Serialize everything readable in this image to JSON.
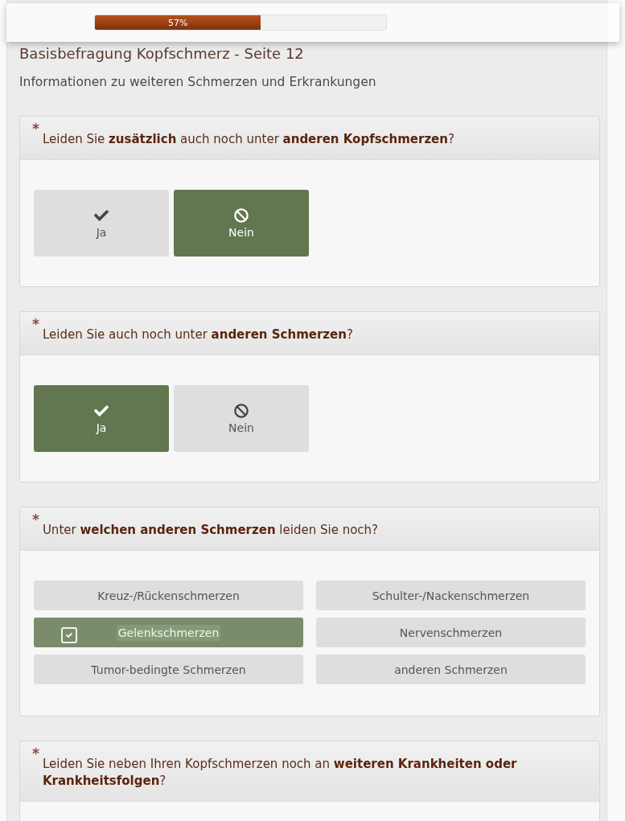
{
  "progress": {
    "level": 0.57,
    "label": "57%"
  },
  "page_title": "Basisbefragung Kopfschmerz - Seite 12",
  "page_subtitle": "Informationen zu weiteren Schmerzen und Erkrankungen",
  "questions": [
    {
      "kind": "yesno",
      "required_mark": "*",
      "text": "Leiden Sie **zusätzlich** auch noch unter **anderen Kopfschmerzen**?",
      "options": [
        {
          "label": "Ja",
          "selected": false
        },
        {
          "label": "Nein",
          "selected": true
        }
      ]
    },
    {
      "kind": "yesno",
      "required_mark": "*",
      "text": "Leiden Sie auch noch unter **anderen Schmerzen**?",
      "options": [
        {
          "label": "Ja",
          "selected": true
        },
        {
          "label": "Nein",
          "selected": false
        }
      ]
    },
    {
      "kind": "multi",
      "required_mark": "*",
      "text": "Unter **welchen anderen Schmerzen** leiden Sie noch?",
      "options": [
        {
          "label": "Kreuz-/Rückenschmerzen",
          "selected": false
        },
        {
          "label": "Schulter-/Nackenschmerzen",
          "selected": false
        },
        {
          "label": "Gelenkschmerzen",
          "selected": true
        },
        {
          "label": "Nervenschmerzen",
          "selected": false
        },
        {
          "label": "Tumor-bedingte Schmerzen",
          "selected": false
        },
        {
          "label": "anderen Schmerzen",
          "selected": false
        }
      ]
    },
    {
      "kind": "open",
      "required_mark": "*",
      "text": "Leiden Sie neben Ihren Kopfschmerzen noch an **weiteren Krankheiten oder Krankheitsfolgen**?"
    }
  ]
}
